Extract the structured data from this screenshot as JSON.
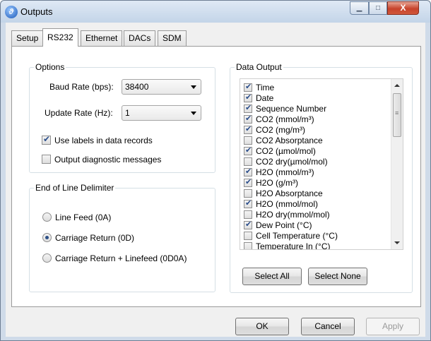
{
  "window": {
    "title": "Outputs",
    "icon": "app-logo-icon",
    "controls": {
      "minimize": "▁",
      "maximize": "□",
      "close": "X"
    }
  },
  "tabs": [
    {
      "label": "Setup",
      "active": false
    },
    {
      "label": "RS232",
      "active": true
    },
    {
      "label": "Ethernet",
      "active": false
    },
    {
      "label": "DACs",
      "active": false
    },
    {
      "label": "SDM",
      "active": false
    }
  ],
  "options": {
    "title": "Options",
    "baud_label": "Baud Rate (bps):",
    "baud_value": "38400",
    "update_label": "Update Rate (Hz):",
    "update_value": "1",
    "use_labels": {
      "label": "Use labels in data records",
      "checked": true
    },
    "diagnostics": {
      "label": "Output diagnostic messages",
      "checked": false
    }
  },
  "eol": {
    "title": "End of Line Delimiter",
    "options": [
      {
        "label": "Line Feed (0A)",
        "selected": false
      },
      {
        "label": "Carriage Return (0D)",
        "selected": true
      },
      {
        "label": "Carriage Return + Linefeed (0D0A)",
        "selected": false
      }
    ]
  },
  "data_output": {
    "title": "Data Output",
    "items": [
      {
        "label": "Time",
        "checked": true
      },
      {
        "label": "Date",
        "checked": true
      },
      {
        "label": "Sequence Number",
        "checked": true
      },
      {
        "label": "CO2 (mmol/m³)",
        "checked": true
      },
      {
        "label": "CO2 (mg/m³)",
        "checked": true
      },
      {
        "label": "CO2 Absorptance",
        "checked": false
      },
      {
        "label": "CO2 (µmol/mol)",
        "checked": true
      },
      {
        "label": "CO2 dry(µmol/mol)",
        "checked": false
      },
      {
        "label": "H2O (mmol/m³)",
        "checked": true
      },
      {
        "label": "H2O (g/m³)",
        "checked": true
      },
      {
        "label": "H2O Absorptance",
        "checked": false
      },
      {
        "label": "H2O (mmol/mol)",
        "checked": true
      },
      {
        "label": "H2O dry(mmol/mol)",
        "checked": false
      },
      {
        "label": "Dew Point (°C)",
        "checked": true
      },
      {
        "label": "Cell Temperature (°C)",
        "checked": false
      },
      {
        "label": "Temperature In (°C)",
        "checked": false
      }
    ],
    "select_all": "Select All",
    "select_none": "Select None"
  },
  "footer": {
    "ok": "OK",
    "cancel": "Cancel",
    "apply": "Apply"
  }
}
